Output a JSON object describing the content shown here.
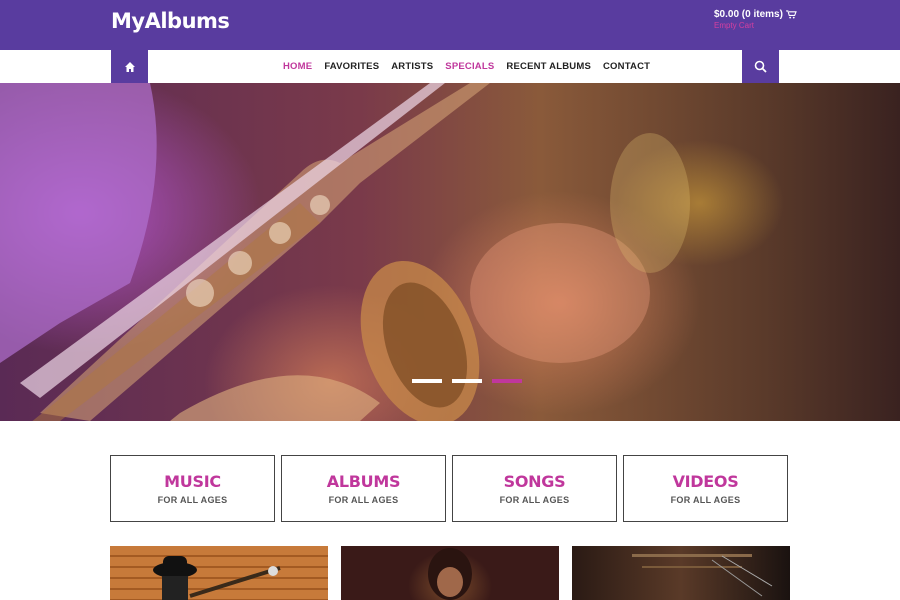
{
  "header": {
    "logo": "MyAlbums",
    "cart_total": "$0.00 (0 items)",
    "cart_sub": "Empty Cart",
    "brand_color": "#593c9f",
    "accent_color": "#c0379c"
  },
  "nav": {
    "home_icon": "home-icon",
    "search_icon": "search-icon",
    "items": [
      {
        "label": "HOME",
        "state": "active"
      },
      {
        "label": "FAVORITES"
      },
      {
        "label": "ARTISTS"
      },
      {
        "label": "SPECIALS",
        "state": "highlight"
      },
      {
        "label": "RECENT ALBUMS"
      },
      {
        "label": "CONTACT"
      }
    ]
  },
  "hero": {
    "slide_count": 3,
    "active_slide": 3
  },
  "categories": [
    {
      "title": "MUSIC",
      "subtitle": "FOR ALL AGES"
    },
    {
      "title": "ALBUMS",
      "subtitle": "FOR ALL AGES"
    },
    {
      "title": "SONGS",
      "subtitle": "FOR ALL AGES"
    },
    {
      "title": "VIDEOS",
      "subtitle": "FOR ALL AGES"
    }
  ]
}
